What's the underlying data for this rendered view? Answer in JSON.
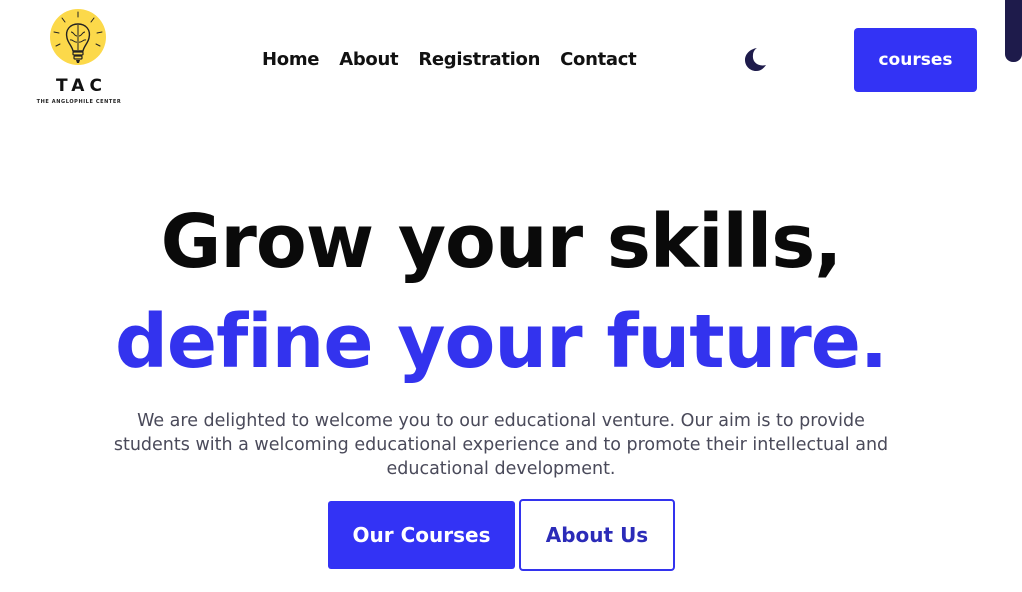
{
  "logo": {
    "title": "TAC",
    "subtitle": "THE ANGLOPHILE CENTER",
    "icon": "lightbulb-brain-icon",
    "color": "#fcd94a"
  },
  "nav": {
    "items": [
      "Home",
      "About",
      "Registration",
      "Contact"
    ]
  },
  "theme_toggle": {
    "icon": "moon-icon"
  },
  "header": {
    "courses_label": "courses"
  },
  "hero": {
    "line1": "Grow your skills,",
    "line2": "define your future.",
    "description": "We are delighted to welcome you to our educational venture. Our aim is to provide students with a welcoming educational experience and to promote their intellectual and educational development.",
    "primary_button": "Our Courses",
    "secondary_button": "About Us"
  },
  "colors": {
    "accent": "#3333f5",
    "heading": "#0a0a0a",
    "scrollbar": "#1e1b4b"
  }
}
